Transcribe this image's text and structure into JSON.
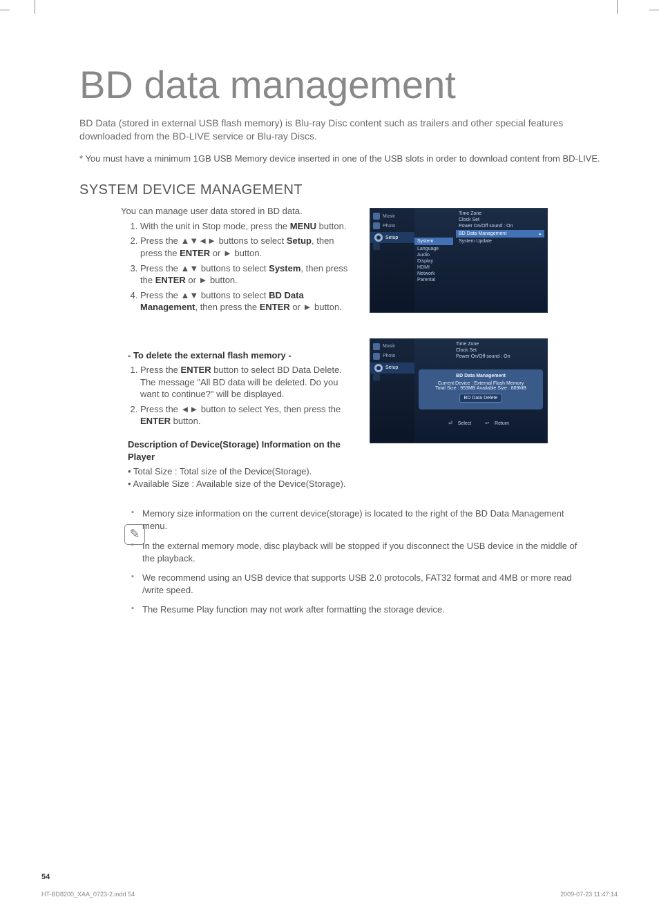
{
  "page_title": "BD data management",
  "intro": "BD Data (stored in external USB flash memory) is Blu-ray Disc content such as trailers and other special features downloaded from the BD-LIVE service or Blu-ray Discs.",
  "star_note": "* You must have a minimum 1GB USB Memory device inserted in one of the USB slots in order to download content from BD-LIVE.",
  "section_heading": "SYSTEM DEVICE MANAGEMENT",
  "lead_sentence": "You can manage user data stored in BD data.",
  "steps_a": {
    "s1_pre": "With the unit in Stop mode, press the ",
    "s1_b": "MENU",
    "s1_post": " button.",
    "s2_pre": "Press the ▲▼◄► buttons to select ",
    "s2_b": "Setup",
    "s2_mid": ", then press the ",
    "s2_b2": "ENTER",
    "s2_post": " or ► button.",
    "s3_pre": "Press the ▲▼ buttons to select ",
    "s3_b": "System",
    "s3_mid": ", then press the ",
    "s3_b2": "ENTER",
    "s3_post": " or ► button.",
    "s4_pre": "Press the ▲▼ buttons to select ",
    "s4_b": "BD Data Management",
    "s4_mid": ", then press the  ",
    "s4_b2": "ENTER",
    "s4_post": " or ► button."
  },
  "sub_heading_delete": "- To delete the external flash memory -",
  "steps_b": {
    "s1_pre": "Press the ",
    "s1_b": "ENTER",
    "s1_post": " button to select BD Data Delete. The message \"All BD data will be deleted. Do you want to continue?\" will be displayed.",
    "s2_pre": "Press the ◄► button to select Yes, then press the ",
    "s2_b": "ENTER",
    "s2_post": " button."
  },
  "desc_heading": "Description of Device(Storage) Information on the Player",
  "desc_bullets": [
    "Total Size : Total size of the Device(Storage).",
    "Available Size : Available size of the Device(Storage)."
  ],
  "notes": [
    "Memory size information on the current device(storage) is located to the right of the BD Data Management menu.",
    "In the external memory mode, disc playback will be stopped if you disconnect the USB device in the middle of the playback.",
    "We recommend using an USB device that supports USB 2.0 protocols, FAT32 format and 4MB or more read /write speed.",
    "The Resume Play function may not work after formatting the storage device."
  ],
  "screenshot1": {
    "left_tabs": [
      "Music",
      "Photo",
      "Setup"
    ],
    "mid_items": [
      "System",
      "Language",
      "Audio",
      "Display",
      "HDMI",
      "Network",
      "Parental"
    ],
    "right_top": [
      "Time Zone",
      "Clock Set",
      "Power On/Off sound  :  On"
    ],
    "right_items": [
      "BD Data Management",
      "System Update"
    ]
  },
  "screenshot2": {
    "left_tabs": [
      "Music",
      "Photo",
      "Setup"
    ],
    "right_top": [
      "Time Zone",
      "Clock Set",
      "Power On/Off sound  :  On"
    ],
    "panel_title": "BD Data Management",
    "panel_line1": "Current Device : External Flash Memory",
    "panel_line2": "Total Size : 953MB      Available Size : 889MB",
    "panel_button": "BD Data Delete",
    "hint_select": "Select",
    "hint_return": "Return"
  },
  "page_number": "54",
  "footer_file": "HT-BD8200_XAA_0723-2.indd   54",
  "footer_date": "2009-07-23    11:47:14",
  "pencil_glyph": "✎"
}
